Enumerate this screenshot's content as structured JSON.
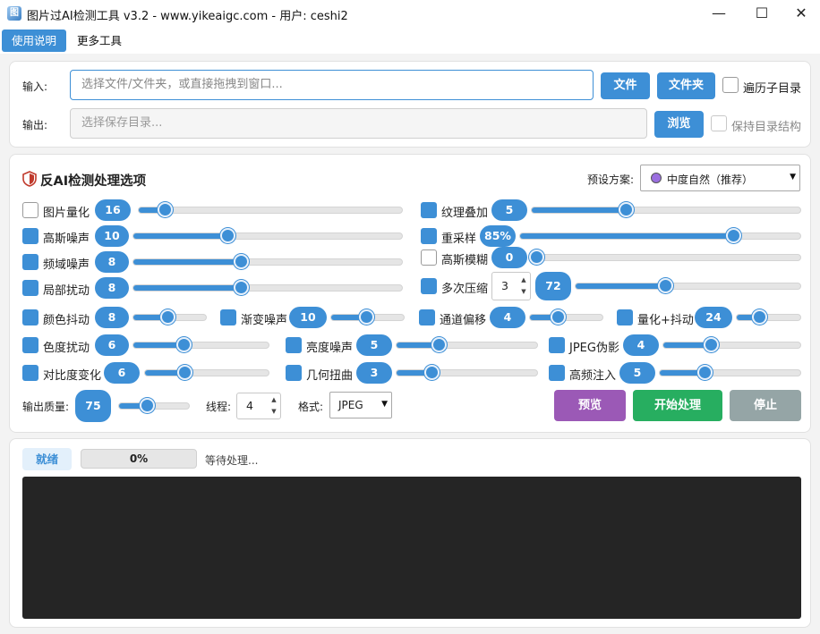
{
  "window": {
    "title": "图片过AI检测工具 v3.2 - www.yikeaigc.com - 用户: ceshi2",
    "icon_text": "图",
    "controls": {
      "minimize": "—",
      "maximize": "☐",
      "close": "✕"
    }
  },
  "menu": {
    "help": "使用说明",
    "tools": "更多工具"
  },
  "io": {
    "input_label": "输入:",
    "input_placeholder": "选择文件/文件夹，或直接拖拽到窗口...",
    "file_button": "文件",
    "folder_button": "文件夹",
    "recurse_label": "遍历子目录",
    "output_label": "输出:",
    "output_placeholder": "选择保存目录...",
    "browse_button": "浏览",
    "keep_structure_label": "保持目录结构"
  },
  "options": {
    "header": "反AI检测处理选项",
    "preset_label": "预设方案:",
    "preset_value": "中度自然（推荐）",
    "preset_color": "#9b6fe0",
    "items": {
      "quantize": {
        "label": "图片量化",
        "value": "16",
        "checked": false,
        "level": 0.1
      },
      "gauss_noise": {
        "label": "高斯噪声",
        "value": "10",
        "checked": true,
        "level": 0.35
      },
      "freq_noise": {
        "label": "频域噪声",
        "value": "8",
        "checked": true,
        "level": 0.4
      },
      "local_jitter": {
        "label": "局部扰动",
        "value": "8",
        "checked": true,
        "level": 0.4
      },
      "texture": {
        "label": "纹理叠加",
        "value": "5",
        "checked": true,
        "level": 0.35
      },
      "resample": {
        "label": "重采样",
        "value": "85%",
        "checked": true,
        "level": 0.76
      },
      "gauss_blur": {
        "label": "高斯模糊",
        "value": "0",
        "checked": false,
        "level": 0.0
      },
      "multi_compress": {
        "label": "多次压缩",
        "spin": "3",
        "value": "72",
        "checked": true,
        "level": 0.4
      },
      "color_jitter": {
        "label": "颜色抖动",
        "value": "8",
        "checked": true,
        "level": 0.47
      },
      "grad_noise": {
        "label": "渐变噪声",
        "value": "10",
        "checked": true,
        "level": 0.48
      },
      "channel_shift": {
        "label": "通道偏移",
        "value": "4",
        "checked": true,
        "level": 0.38
      },
      "quant_jitter": {
        "label": "量化+抖动",
        "value": "24",
        "checked": true,
        "level": 0.35
      },
      "hue_jitter": {
        "label": "色度扰动",
        "value": "6",
        "checked": true,
        "level": 0.37
      },
      "bright_noise": {
        "label": "亮度噪声",
        "value": "5",
        "checked": true,
        "level": 0.3
      },
      "jpeg_artifact": {
        "label": "JPEG伪影",
        "value": "4",
        "checked": true,
        "level": 0.35
      },
      "contrast": {
        "label": "对比度变化",
        "value": "6",
        "checked": true,
        "level": 0.32
      },
      "geo_warp": {
        "label": "几何扭曲",
        "value": "3",
        "checked": true,
        "level": 0.25
      },
      "hf_inject": {
        "label": "高频注入",
        "value": "5",
        "checked": true,
        "level": 0.32
      }
    },
    "quality_label": "输出质量:",
    "quality_value": "75",
    "quality_level": 0.4,
    "threads_label": "线程:",
    "threads_value": "4",
    "format_label": "格式:",
    "format_value": "JPEG",
    "preview_button": "预览",
    "start_button": "开始处理",
    "stop_button": "停止",
    "colors": {
      "accent": "#3d8fd6",
      "preview": "#9b59b6",
      "start": "#27ae60",
      "stop": "#95a5a6"
    }
  },
  "status": {
    "chip": "就绪",
    "progress": "0%",
    "progress_level": 0.0,
    "message": "等待处理..."
  }
}
